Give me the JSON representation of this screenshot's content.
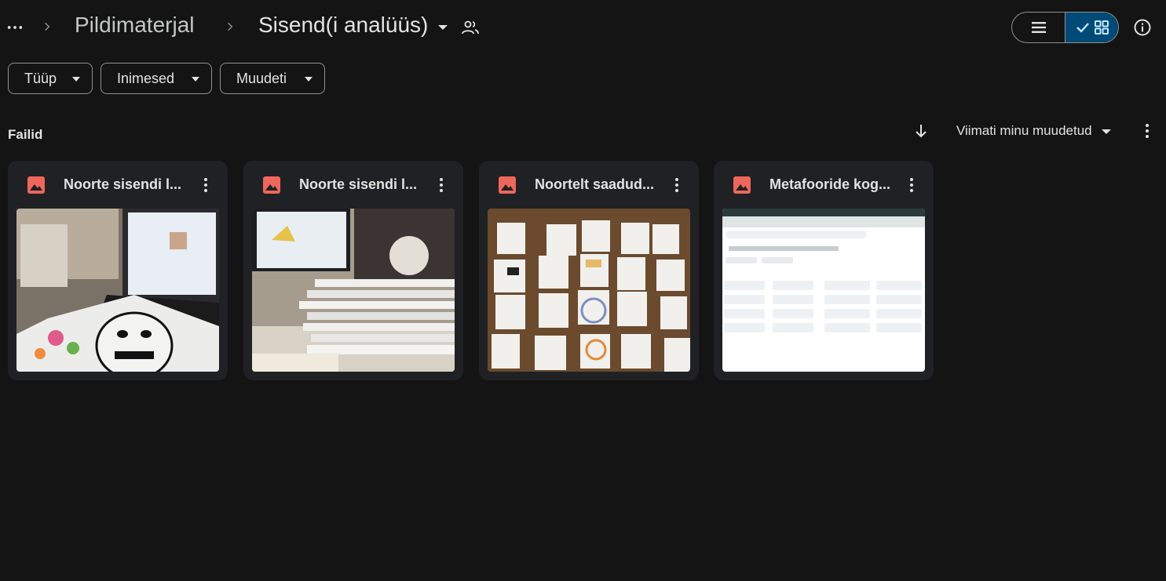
{
  "breadcrumb": {
    "more_icon": "more-horiz-icon",
    "parent": "Pildimaterjal",
    "current": "Sisend(i analüüs)",
    "shared_icon": "people-icon"
  },
  "view": {
    "list_icon": "list-view-icon",
    "grid_icon": "grid-view-icon",
    "selected": "grid"
  },
  "filters": [
    {
      "label": "Tüüp"
    },
    {
      "label": "Inimesed"
    },
    {
      "label": "Muudeti"
    }
  ],
  "section": {
    "title": "Failid",
    "sort_label": "Viimati minu muudetud",
    "sort_direction_icon": "arrow-down-icon"
  },
  "files": [
    {
      "title": "Noorte sisendi l...",
      "type_icon": "image-file-icon"
    },
    {
      "title": "Noorte sisendi l...",
      "type_icon": "image-file-icon"
    },
    {
      "title": "Noortelt saadud...",
      "type_icon": "image-file-icon"
    },
    {
      "title": "Metafooride kog...",
      "type_icon": "image-file-icon"
    }
  ],
  "colors": {
    "background": "#141414",
    "card": "#202124",
    "selected_toggle": "#004a77",
    "image_icon": "#ee675c"
  }
}
